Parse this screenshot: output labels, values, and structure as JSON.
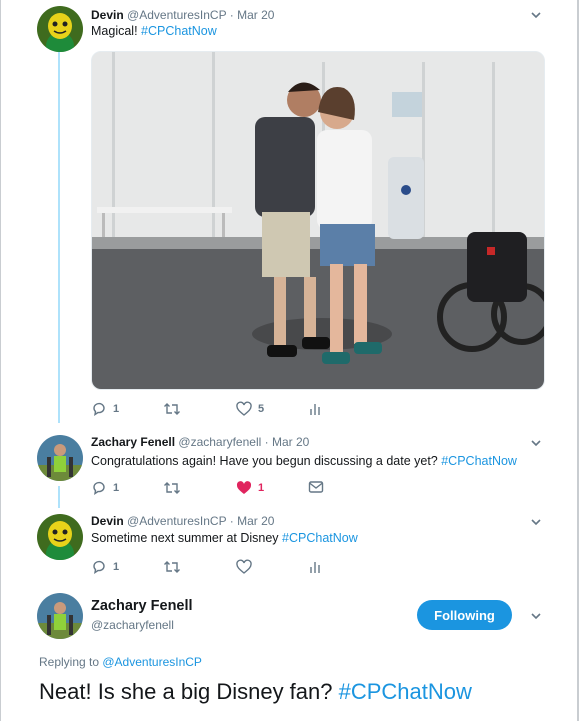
{
  "tweets": [
    {
      "name": "Devin",
      "handle": "@AdventuresInCP",
      "date": "Mar 20",
      "text": "Magical! ",
      "hashtag": "#CPChatNow",
      "reply_count": "1",
      "retweet_count": "",
      "like_count": "5",
      "has_media": true,
      "media_description": "photo"
    },
    {
      "name": "Zachary Fenell",
      "handle": "@zacharyfenell",
      "date": "Mar 20",
      "text": "Congratulations again! Have you begun discussing a date yet? ",
      "hashtag": "#CPChatNow",
      "reply_count": "1",
      "like_count": "1",
      "liked": true
    },
    {
      "name": "Devin",
      "handle": "@AdventuresInCP",
      "date": "Mar 20",
      "text": "Sometime next summer at Disney ",
      "hashtag": "#CPChatNow",
      "reply_count": "1",
      "like_count": ""
    }
  ],
  "main_tweet": {
    "name": "Zachary Fenell",
    "handle": "@zacharyfenell",
    "follow_label": "Following",
    "replying_prefix": "Replying to ",
    "replying_to": "@AdventuresInCP",
    "text": "Neat! Is she a big Disney fan? ",
    "hashtag": "#CPChatNow"
  },
  "separator": "·",
  "colors": {
    "accent": "#1b95e0",
    "thread_line": "#aee2fb",
    "like": "#e0245e",
    "muted": "#657786"
  },
  "icons": [
    "reply-icon",
    "retweet-icon",
    "like-icon",
    "analytics-icon",
    "dm-icon",
    "chevron-down-icon"
  ]
}
